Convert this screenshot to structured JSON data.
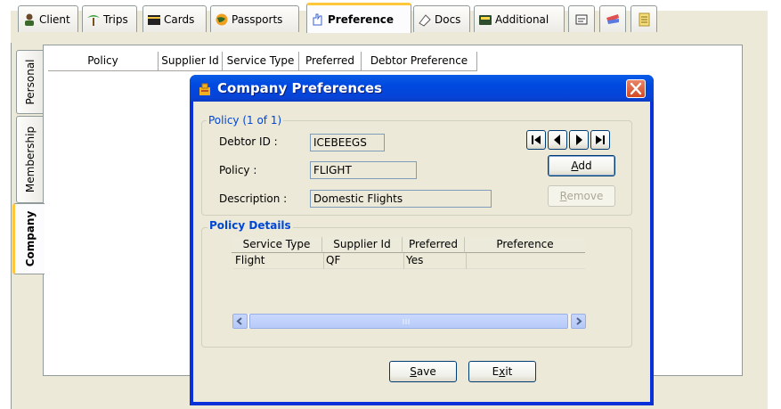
{
  "top_tabs": [
    {
      "label": "Client",
      "icon": "client-icon"
    },
    {
      "label": "Trips",
      "icon": "palm-tree-icon"
    },
    {
      "label": "Cards",
      "icon": "cards-icon"
    },
    {
      "label": "Passports",
      "icon": "globe-icon"
    },
    {
      "label": "Preference",
      "icon": "preference-icon",
      "active": true
    },
    {
      "label": "Docs",
      "icon": "docs-icon"
    },
    {
      "label": "Additional",
      "icon": "additional-icon"
    }
  ],
  "icon_tabs": [
    "note-icon",
    "tickets-icon",
    "notepad-icon"
  ],
  "side_tabs": [
    "Personal",
    "Membership",
    "Company"
  ],
  "active_side_tab": "Company",
  "main_grid": {
    "columns": [
      "Policy",
      "Supplier Id",
      "Service Type",
      "Preferred",
      "Debtor Preference"
    ]
  },
  "dialog": {
    "title": "Company Preferences",
    "policy_group_legend": "Policy (1 of 1)",
    "fields": {
      "debtor_id": {
        "label": "Debtor ID :",
        "value": "ICEBEEGS"
      },
      "policy": {
        "label": "Policy :",
        "value": "FLIGHT"
      },
      "description": {
        "label": "Description :",
        "value": "Domestic Flights"
      }
    },
    "buttons": {
      "add": "Add",
      "add_underline": "A",
      "add_rest": "dd",
      "remove": "Remove",
      "remove_underline": "R",
      "remove_rest": "emove",
      "save_underline": "S",
      "save_rest": "ave",
      "exit_first": "E",
      "exit_underline": "x",
      "exit_rest": "it"
    },
    "details": {
      "legend": "Policy Details",
      "columns": [
        "Service Type",
        "Supplier Id",
        "Preferred",
        "Preference"
      ],
      "rows": [
        {
          "service_type": "Flight",
          "supplier_id": "QF",
          "preferred": "Yes",
          "preference": ""
        }
      ]
    }
  },
  "colors": {
    "xp_blue": "#0831d9",
    "tab_highlight": "#ffc83c",
    "legend_blue": "#0046d5",
    "dialog_face": "#ece9d8"
  }
}
